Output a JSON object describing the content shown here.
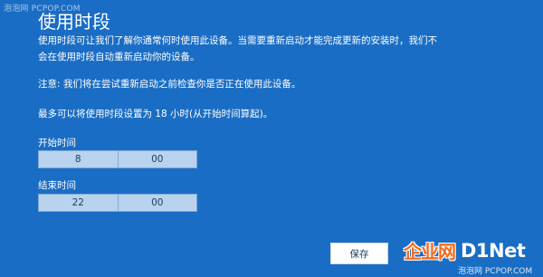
{
  "watermark_top": "泡泡网 PCPOP.COM",
  "page": {
    "title": "使用时段",
    "description_lines": [
      "使用时段可让我们了解你通常何时使用此设备。当需要重新启动才能完成更新的安装时，我们不",
      "会在使用时段自动重新启动你的设备。"
    ],
    "note": "注意: 我们将在尝试重新启动之前检查你是否正在使用此设备。",
    "max_info": "最多可以将使用时段设置为 18 小时(从开始时间算起)。"
  },
  "start_time": {
    "label": "开始时间",
    "hour": "8",
    "minute": "00"
  },
  "end_time": {
    "label": "结束时间",
    "hour": "22",
    "minute": "00"
  },
  "save_label": "保存",
  "logo": {
    "cn": "企业网",
    "en": "D1Net"
  },
  "watermark_bottom": "泡泡网 PCPOP.COM",
  "colors": {
    "background": "#1a6dc4",
    "picker": "#b9d3ee",
    "logo_accent": "#f36a1b"
  }
}
